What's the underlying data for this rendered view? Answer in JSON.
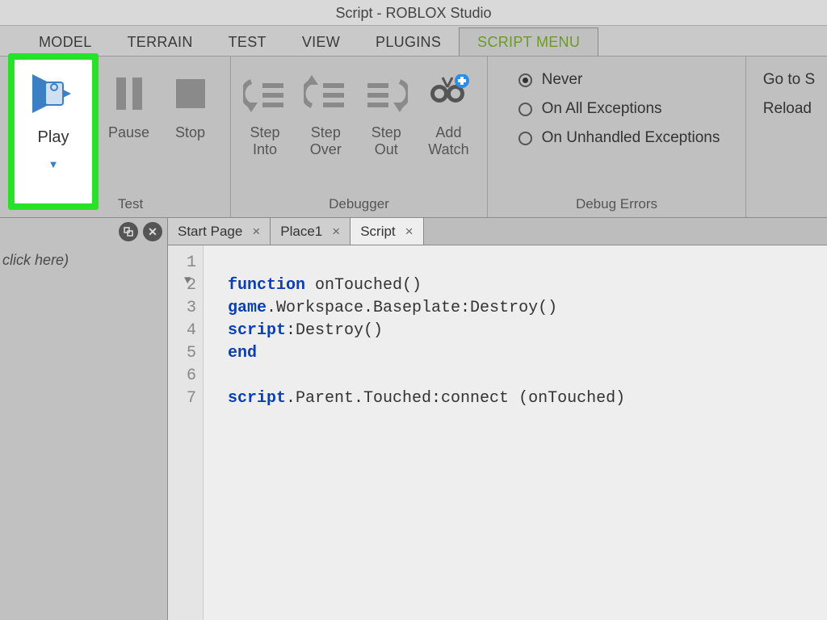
{
  "title": "Script - ROBLOX Studio",
  "top_tabs": {
    "items": [
      "MODEL",
      "TERRAIN",
      "TEST",
      "VIEW",
      "PLUGINS",
      "SCRIPT MENU"
    ],
    "active_index": 5
  },
  "ribbon": {
    "play": {
      "label": "Play"
    },
    "pause": {
      "label": "Pause"
    },
    "stop": {
      "label": "Stop"
    },
    "test_group": "Test",
    "step_into": "Step\nInto",
    "step_over": "Step\nOver",
    "step_out": "Step\nOut",
    "add_watch": "Add\nWatch",
    "debugger_group": "Debugger",
    "debug_errors_group": "Debug Errors",
    "debug_opts": {
      "never": "Never",
      "on_all": "On All Exceptions",
      "on_unhandled": "On Unhandled Exceptions",
      "selected": "never"
    },
    "actions": {
      "goto": "Go to S",
      "reload": "Reload"
    }
  },
  "side": {
    "filter_hint": "ouble click here)",
    "popout_icon": "popout",
    "close_icon": "close"
  },
  "editor": {
    "tabs": [
      {
        "label": "Start Page",
        "active": false
      },
      {
        "label": "Place1",
        "active": false
      },
      {
        "label": "Script",
        "active": true
      }
    ],
    "line_numbers": [
      "1",
      "2",
      "3",
      "4",
      "5",
      "6",
      "7"
    ],
    "lines": {
      "l1": "",
      "l2_kw": "function",
      "l2_rest": " onTouched()",
      "l3_kw": "game",
      "l3_rest": ".Workspace.Baseplate:Destroy()",
      "l4_kw": "script",
      "l4_rest": ":Destroy()",
      "l5_kw": "end",
      "l6": "",
      "l7_kw": "script",
      "l7_rest": ".Parent.Touched:connect (onTouched)"
    }
  }
}
